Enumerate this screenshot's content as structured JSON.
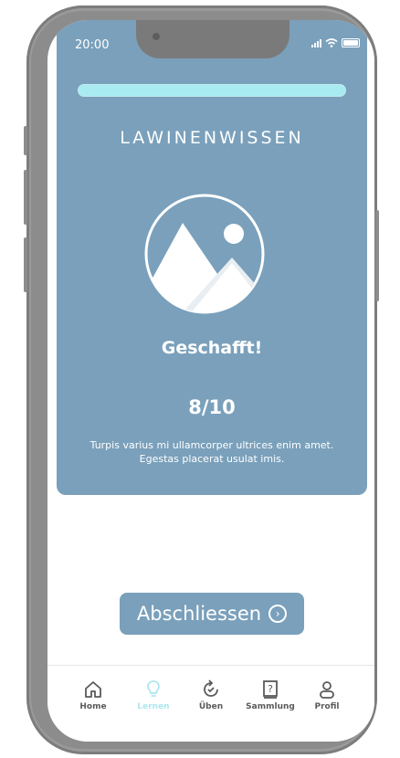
{
  "status": {
    "time": "20:00"
  },
  "quiz": {
    "title": "LAWINENWISSEN",
    "result_label": "Geschafft!",
    "score": "8/10",
    "progress": 1.0,
    "description": "Turpis varius mi ullamcorper ultrices enim amet. Egestas placerat usulat imis."
  },
  "actions": {
    "finish_label": "Abschliessen"
  },
  "nav": {
    "items": [
      {
        "label": "Home",
        "icon": "home-icon"
      },
      {
        "label": "Lernen",
        "icon": "lightbulb-icon",
        "active": true
      },
      {
        "label": "Üben",
        "icon": "refresh-check-icon"
      },
      {
        "label": "Sammlung",
        "icon": "question-book-icon"
      },
      {
        "label": "Profil",
        "icon": "user-icon"
      }
    ]
  },
  "colors": {
    "card": "#7aa0bb",
    "accent": "#a8ecf2",
    "active_nav": "#aee7ee"
  }
}
